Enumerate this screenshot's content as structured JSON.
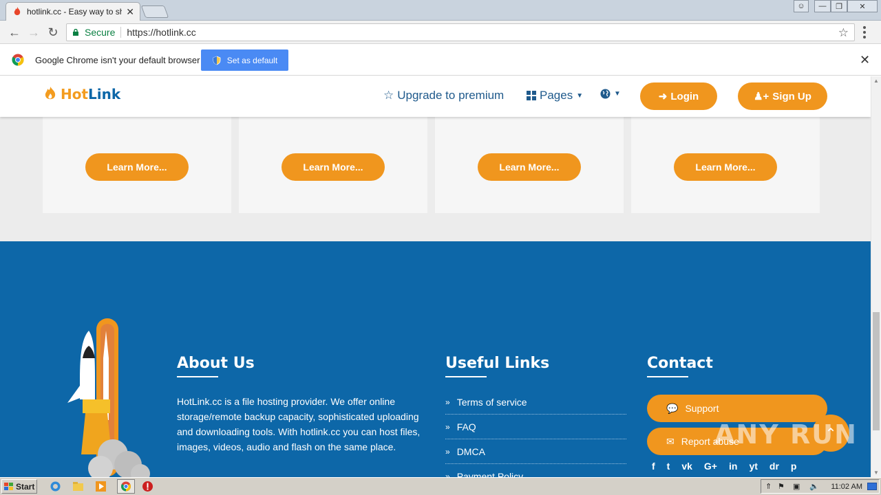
{
  "browser": {
    "tab_title": "hotlink.cc - Easy way to sha",
    "tab_close": "✕",
    "secure_label": "Secure",
    "url": "https://hotlink.cc",
    "window_controls": [
      "user-icon",
      "minimize-icon",
      "restore-icon",
      "close-icon"
    ]
  },
  "infobar": {
    "message": "Google Chrome isn't your default browser",
    "button_label": "Set as default",
    "close": "✕"
  },
  "site": {
    "logo_hot": "Hot",
    "logo_link": "Link",
    "nav": {
      "upgrade": "Upgrade to premium",
      "pages": "Pages",
      "login": "Login",
      "signup": "Sign Up"
    },
    "cards": [
      {
        "button": "Learn More..."
      },
      {
        "button": "Learn More..."
      },
      {
        "button": "Learn More..."
      },
      {
        "button": "Learn More..."
      }
    ],
    "footer": {
      "about_heading": "About Us",
      "about_text": "HotLink.cc is a file hosting provider. We offer online storage/remote backup capacity, sophisticated uploading and downloading tools. With hotlink.cc you can host files, images, videos, audio and flash on the same place.",
      "links_heading": "Useful Links",
      "links": [
        "Terms of service",
        "FAQ",
        "DMCA",
        "Payment Policy"
      ],
      "contact_heading": "Contact",
      "support": "Support",
      "report": "Report abuse",
      "social": [
        "f",
        "t",
        "vk",
        "G+",
        "in",
        "yt",
        "dr",
        "p"
      ]
    },
    "colors": {
      "accent_orange": "#f0961e",
      "footer_blue": "#0d67a8"
    }
  },
  "watermark": "ANY RUN",
  "taskbar": {
    "start": "Start",
    "clock": "11:02 AM"
  }
}
